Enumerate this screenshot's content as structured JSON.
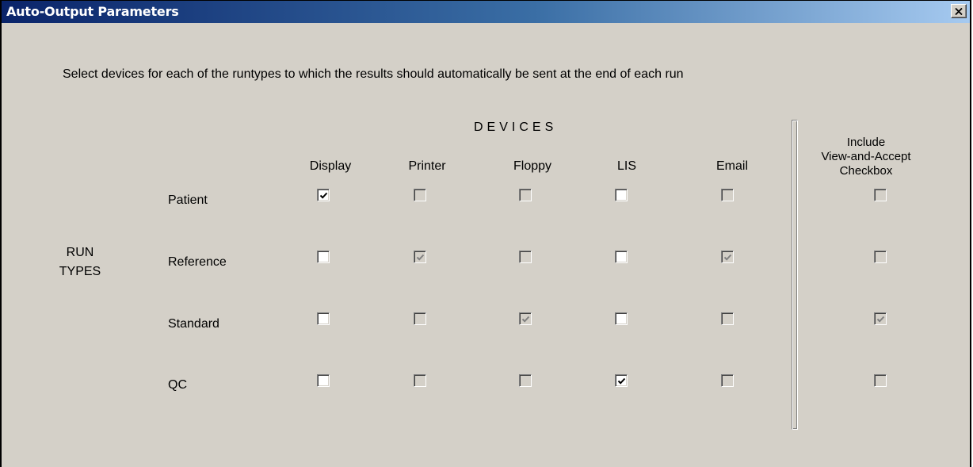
{
  "window": {
    "title": "Auto-Output Parameters",
    "close_icon": "close-icon"
  },
  "instruction": "Select devices for each of the runtypes to which the results should automatically be sent at the end of each run",
  "devices_heading": "DEVICES",
  "columns": [
    "Display",
    "Printer",
    "Floppy",
    "LIS",
    "Email"
  ],
  "include_header": {
    "line1": "Include",
    "line2": "View-and-Accept",
    "line3": "Checkbox"
  },
  "run_types_label": {
    "line1": "RUN",
    "line2": "TYPES"
  },
  "rows": [
    {
      "label": "Patient",
      "cells": [
        {
          "checked": true,
          "enabled": true
        },
        {
          "checked": false,
          "enabled": false
        },
        {
          "checked": false,
          "enabled": false
        },
        {
          "checked": false,
          "enabled": true
        },
        {
          "checked": false,
          "enabled": false
        }
      ],
      "include": {
        "checked": false,
        "enabled": false
      }
    },
    {
      "label": "Reference",
      "cells": [
        {
          "checked": false,
          "enabled": true
        },
        {
          "checked": true,
          "enabled": false
        },
        {
          "checked": false,
          "enabled": false
        },
        {
          "checked": false,
          "enabled": true
        },
        {
          "checked": true,
          "enabled": false
        }
      ],
      "include": {
        "checked": false,
        "enabled": false
      }
    },
    {
      "label": "Standard",
      "cells": [
        {
          "checked": false,
          "enabled": true
        },
        {
          "checked": false,
          "enabled": false
        },
        {
          "checked": true,
          "enabled": false
        },
        {
          "checked": false,
          "enabled": true
        },
        {
          "checked": false,
          "enabled": false
        }
      ],
      "include": {
        "checked": true,
        "enabled": false
      }
    },
    {
      "label": "QC",
      "cells": [
        {
          "checked": false,
          "enabled": true
        },
        {
          "checked": false,
          "enabled": false
        },
        {
          "checked": false,
          "enabled": false
        },
        {
          "checked": true,
          "enabled": true
        },
        {
          "checked": false,
          "enabled": false
        }
      ],
      "include": {
        "checked": false,
        "enabled": false
      }
    }
  ]
}
